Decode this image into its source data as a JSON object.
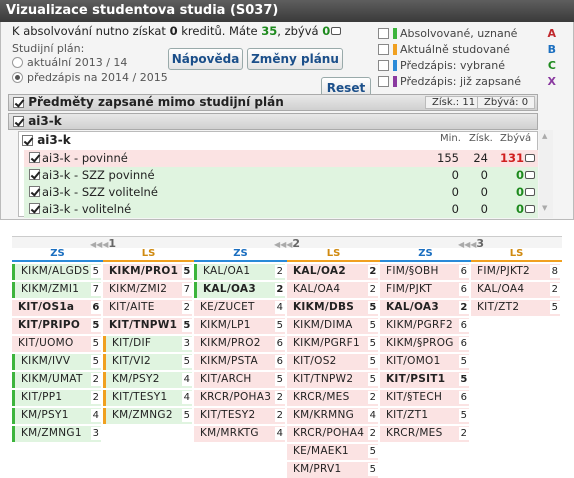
{
  "title": "Vizualizace studentova studia (S037)",
  "info": {
    "pre": "K absolvování nutno získat ",
    "credits_needed": "0",
    "mid": " kreditů. Máte ",
    "credits_have": "35",
    "post": ", zbývá ",
    "remaining": "0"
  },
  "plan": {
    "label": "Studijní plán:",
    "options": [
      "aktuální 2013 / 14",
      "předzápis na 2014 / 2015"
    ],
    "selected": 1
  },
  "buttons": {
    "help": "Nápověda",
    "changes": "Změny plánu",
    "reset": "Reset"
  },
  "legend": [
    {
      "label": "Absolvované, uznané",
      "letter": "A",
      "color": "#3cb43c",
      "letter_color": "#c0282d"
    },
    {
      "label": "Aktuálně studované",
      "letter": "B",
      "color": "#f0a020",
      "letter_color": "#1b6fc0"
    },
    {
      "label": "Předzápis: vybrané",
      "letter": "C",
      "color": "#2a8ad8",
      "letter_color": "#1e8a1e"
    },
    {
      "label": "Předzápis: již zapsané",
      "letter": "X",
      "color": "#8a3aa0",
      "letter_color": "#8a3aa0"
    }
  ],
  "outside_plan": {
    "label": "Předměty zapsané mimo studijní plán",
    "earned": "Získ.: 11",
    "remaining": "Zbývá: 0"
  },
  "group": {
    "label": "ai3-k"
  },
  "sub_group": {
    "label": "ai3-k",
    "col_min": "Min.",
    "col_earned": "Získ.",
    "col_remaining": "Zbývá"
  },
  "rows": [
    {
      "name": "ai3-k - povinné",
      "min": "155",
      "earned": "24",
      "remaining": "131",
      "red": true
    },
    {
      "name": "ai3-k - SZZ povinné",
      "min": "0",
      "earned": "0",
      "remaining": "0"
    },
    {
      "name": "ai3-k - SZZ volitelné",
      "min": "0",
      "earned": "0",
      "remaining": "0"
    },
    {
      "name": "ai3-k - volitelné",
      "min": "0",
      "earned": "0",
      "remaining": "0"
    }
  ],
  "years": [
    {
      "label": "1",
      "zs": "ZS",
      "ls": "LS",
      "zs_items": [
        [
          "KIKM/ALGDS",
          "5",
          "g",
          false
        ],
        [
          "KIKM/ZMI1",
          "7",
          "g",
          false
        ],
        [
          "KIT/OS1a",
          "6",
          "p",
          true
        ],
        [
          "KIT/PRIPO",
          "5",
          "p",
          true
        ],
        [
          "KIT/UOMO",
          "5",
          "p",
          false
        ],
        [
          "KIKM/IVV",
          "5",
          "g",
          false
        ],
        [
          "KIKM/UMAT",
          "2",
          "g",
          false
        ],
        [
          "KIT/PP1",
          "2",
          "g",
          false
        ],
        [
          "KM/PSY1",
          "4",
          "g",
          false
        ],
        [
          "KM/ZMNG1",
          "3",
          "g",
          false
        ]
      ],
      "ls_items": [
        [
          "KIKM/PRO1",
          "5",
          "p",
          true
        ],
        [
          "KIKM/ZMI2",
          "7",
          "p",
          false
        ],
        [
          "KIT/AITE",
          "2",
          "p",
          false
        ],
        [
          "KIT/TNPW1",
          "5",
          "p",
          true
        ],
        [
          "KIT/DIF",
          "3",
          "o",
          false
        ],
        [
          "KIT/VI2",
          "5",
          "o",
          false
        ],
        [
          "KM/PSY2",
          "4",
          "o",
          false
        ],
        [
          "KIT/TESY1",
          "4",
          "o",
          false
        ],
        [
          "KM/ZMNG2",
          "5",
          "o",
          false
        ]
      ]
    },
    {
      "label": "2",
      "zs": "ZS",
      "ls": "LS",
      "zs_items": [
        [
          "KAL/OA1",
          "2",
          "g",
          false
        ],
        [
          "KAL/OA3",
          "2",
          "g",
          true
        ],
        [
          "KE/ZUCET",
          "4",
          "p",
          false
        ],
        [
          "KIKM/LP1",
          "5",
          "p",
          false
        ],
        [
          "KIKM/PRO2",
          "6",
          "p",
          false
        ],
        [
          "KIKM/PSTA",
          "6",
          "p",
          false
        ],
        [
          "KIT/ARCH",
          "5",
          "p",
          false
        ],
        [
          "KRCR/POHA3",
          "2",
          "p",
          false
        ],
        [
          "KIT/TESY2",
          "2",
          "p",
          false
        ],
        [
          "KM/MRKTG",
          "4",
          "p",
          false
        ]
      ],
      "ls_items": [
        [
          "KAL/OA2",
          "2",
          "p",
          true
        ],
        [
          "KAL/OA4",
          "2",
          "p",
          false
        ],
        [
          "KIKM/DBS",
          "5",
          "p",
          true
        ],
        [
          "KIKM/DIMA",
          "5",
          "p",
          false
        ],
        [
          "KIKM/PGRF1",
          "5",
          "p",
          false
        ],
        [
          "KIT/OS2",
          "5",
          "p",
          false
        ],
        [
          "KIT/TNPW2",
          "5",
          "p",
          false
        ],
        [
          "KRCR/MES",
          "2",
          "p",
          false
        ],
        [
          "KM/KRMNG",
          "4",
          "p",
          false
        ],
        [
          "KRCR/POHA4",
          "2",
          "p",
          false
        ],
        [
          "KE/MAEK1",
          "5",
          "p",
          false
        ],
        [
          "KM/PRV1",
          "5",
          "p",
          false
        ]
      ]
    },
    {
      "label": "3",
      "zs": "ZS",
      "ls": "LS",
      "zs_items": [
        [
          "FIM/§OBH",
          "6",
          "p",
          false
        ],
        [
          "FIM/PJKT",
          "6",
          "p",
          false
        ],
        [
          "KAL/OA3",
          "2",
          "p",
          true
        ],
        [
          "KIKM/PGRF2",
          "6",
          "p",
          false
        ],
        [
          "KIKM/§PROG",
          "6",
          "p",
          false
        ],
        [
          "KIT/OMO1",
          "5",
          "p",
          false
        ],
        [
          "KIT/PSIT1",
          "5",
          "p",
          true
        ],
        [
          "KIT/§TECH",
          "6",
          "p",
          false
        ],
        [
          "KIT/ZT1",
          "5",
          "p",
          false
        ],
        [
          "KRCR/MES",
          "2",
          "p",
          false
        ]
      ],
      "ls_items": [
        [
          "FIM/PJKT2",
          "8",
          "p",
          false
        ],
        [
          "KAL/OA4",
          "2",
          "p",
          false
        ],
        [
          "KIT/ZT2",
          "5",
          "p",
          false
        ]
      ]
    }
  ],
  "year_arrow": "◀◀◀"
}
